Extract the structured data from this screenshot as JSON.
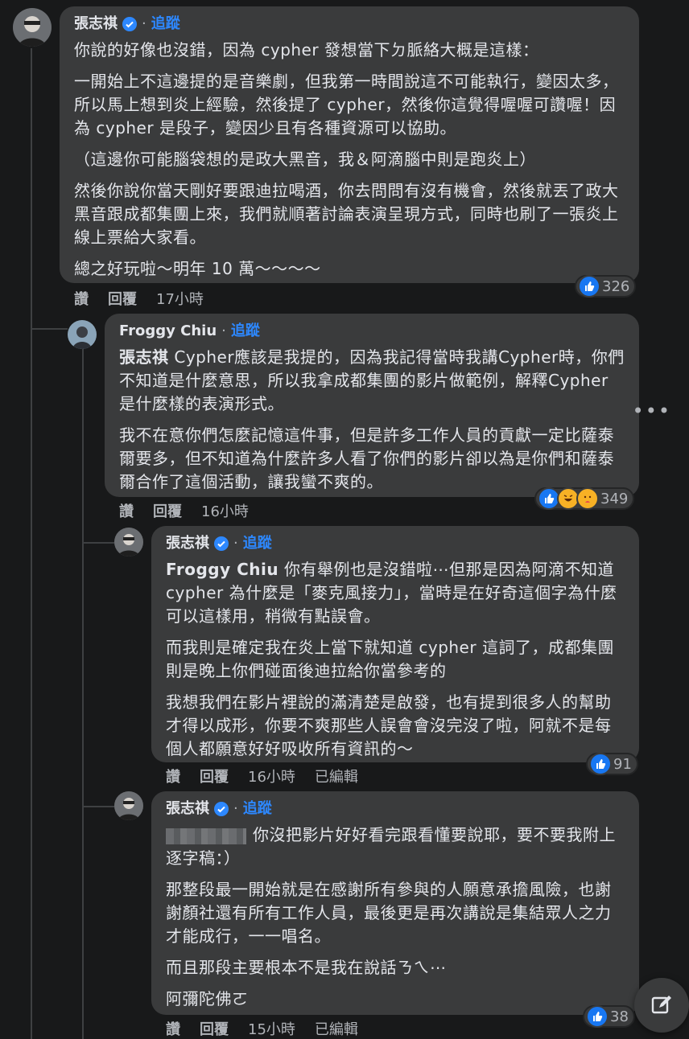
{
  "comments": [
    {
      "author": "張志祺",
      "verified": true,
      "follow": "追蹤",
      "paragraphs": [
        "你說的好像也沒錯，因為 cypher 發想當下ㄉ脈絡大概是這樣：",
        "一開始上不這邊提的是音樂劇，但我第一時間說這不可能執行，變因太多，所以馬上想到炎上經驗，然後提了 cypher，然後你這覺得喔喔可讚喔！因為 cypher 是段子，變因少且有各種資源可以協助。",
        "（這邊你可能腦袋想的是政大黑音，我＆阿滴腦中則是跑炎上）",
        "然後你說你當天剛好要跟迪拉喝酒，你去問問有沒有機會，然後就丟了政大黑音跟成都集團上來，我們就順著討論表演呈現方式，同時也刷了一張炎上線上票給大家看。",
        "總之好玩啦～明年 10 萬～～～～"
      ],
      "actions": {
        "like": "讚",
        "reply": "回覆",
        "time": "17小時"
      },
      "reaction_count": "326"
    },
    {
      "author": "Froggy Chiu",
      "verified": false,
      "follow": "追蹤",
      "mention": "張志祺",
      "paragraphs": [
        " Cypher應該是我提的，因為我記得當時我講Cypher時，你們不知道是什麼意思，所以我拿成都集團的影片做範例，解釋Cypher是什麼樣的表演形式。",
        "我不在意你們怎麼記憶這件事，但是許多工作人員的貢獻一定比薩泰爾要多，但不知道為什麼許多人看了你們的影片卻以為是你們和薩泰爾合作了這個活動，讓我蠻不爽的。"
      ],
      "actions": {
        "like": "讚",
        "reply": "回覆",
        "time": "16小時"
      },
      "reaction_count": "349"
    },
    {
      "author": "張志祺",
      "verified": true,
      "follow": "追蹤",
      "mention": "Froggy Chiu",
      "paragraphs": [
        " 你有舉例也是沒錯啦⋯但那是因為阿滴不知道 cypher 為什麼是「麥克風接力」，當時是在好奇這個字為什麼可以這樣用，稍微有點誤會。",
        "而我則是確定我在炎上當下就知道 cypher 這詞了，成都集團則是晚上你們碰面後迪拉給你當參考的",
        "我想我們在影片裡說的滿清楚是啟發，也有提到很多人的幫助才得以成形，你要不爽那些人誤會會沒完沒了啦，阿就不是每個人都願意好好吸收所有資訊的～"
      ],
      "actions": {
        "like": "讚",
        "reply": "回覆",
        "time": "16小時",
        "edited": "已編輯"
      },
      "reaction_count": "91"
    },
    {
      "author": "張志祺",
      "verified": true,
      "follow": "追蹤",
      "paragraphs": [
        "你沒把影片好好看完跟看懂要說耶，要不要我附上逐字稿：）",
        "那整段最一開始就是在感謝所有參與的人願意承擔風險，也謝謝顏社還有所有工作人員，最後更是再次講說是集結眾人之力才能成行，一一唱名。",
        "而且那段主要根本不是我在說話ㄋㄟ⋯",
        "阿彌陀佛ㄛ"
      ],
      "actions": {
        "like": "讚",
        "reply": "回覆",
        "time": "15小時",
        "edited": "已編輯"
      },
      "reaction_count": "38"
    }
  ],
  "icons": {
    "more": "more-dots-icon",
    "compose": "compose-edit-icon",
    "verified": "verified-badge-icon"
  },
  "colors": {
    "accent": "#2d88ff",
    "bubble": "#3a3b3c",
    "bg": "#18191a"
  }
}
